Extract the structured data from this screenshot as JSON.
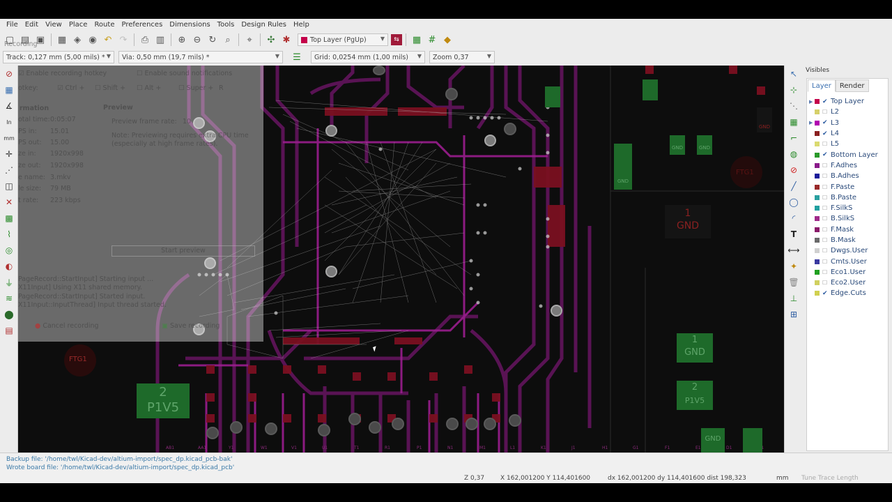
{
  "menu": [
    "File",
    "Edit",
    "View",
    "Place",
    "Route",
    "Preferences",
    "Dimensions",
    "Tools",
    "Design Rules",
    "Help"
  ],
  "toolbar": {
    "layer_combo": "Top Layer (PgUp)",
    "track_combo": "Track: 0,127 mm (5,00 mils) *",
    "via_combo": "Via: 0,50 mm (19,7 mils) *",
    "grid_combo": "Grid: 0,0254 mm (1,00 mils)",
    "zoom_combo": "Zoom 0,37"
  },
  "visibles": {
    "title": "Visibles",
    "tabs": [
      "Layer",
      "Render"
    ],
    "layers": [
      {
        "name": "Top Layer",
        "checked": true,
        "color": "#c4004a",
        "arrow": true
      },
      {
        "name": "L2",
        "checked": false,
        "color": "#d6d06a",
        "arrow": false
      },
      {
        "name": "L3",
        "checked": true,
        "color": "#b000b0",
        "arrow": true
      },
      {
        "name": "L4",
        "checked": true,
        "color": "#8a2020",
        "arrow": false
      },
      {
        "name": "L5",
        "checked": false,
        "color": "#dada70",
        "arrow": false
      },
      {
        "name": "Bottom Layer",
        "checked": true,
        "color": "#2a9a2a",
        "arrow": false
      },
      {
        "name": "F.Adhes",
        "checked": false,
        "color": "#8a1a8a",
        "arrow": false
      },
      {
        "name": "B.Adhes",
        "checked": false,
        "color": "#1a1a9a",
        "arrow": false
      },
      {
        "name": "F.Paste",
        "checked": false,
        "color": "#9a2a2a",
        "arrow": false
      },
      {
        "name": "B.Paste",
        "checked": false,
        "color": "#2aa0a0",
        "arrow": false
      },
      {
        "name": "F.SilkS",
        "checked": false,
        "color": "#20a0a0",
        "arrow": false
      },
      {
        "name": "B.SilkS",
        "checked": false,
        "color": "#a02a8a",
        "arrow": false
      },
      {
        "name": "F.Mask",
        "checked": false,
        "color": "#8a1a6a",
        "arrow": false
      },
      {
        "name": "B.Mask",
        "checked": false,
        "color": "#6a6a6a",
        "arrow": false
      },
      {
        "name": "Dwgs.User",
        "checked": false,
        "color": "#d0d0d0",
        "arrow": false
      },
      {
        "name": "Cmts.User",
        "checked": false,
        "color": "#3a3aa0",
        "arrow": false
      },
      {
        "name": "Eco1.User",
        "checked": false,
        "color": "#20a020",
        "arrow": false
      },
      {
        "name": "Eco2.User",
        "checked": false,
        "color": "#d0d060",
        "arrow": false
      },
      {
        "name": "Edge.Cuts",
        "checked": true,
        "color": "#d0d050",
        "arrow": false
      }
    ]
  },
  "status": {
    "msg1": "Backup file: '/home/twl/Kicad-dev/altium-import/spec_dp.kicad_pcb-bak'",
    "msg2": "Wrote board file: '/home/twl/Kicad-dev/altium-import/spec_dp.kicad_pcb'",
    "zoom": "Z 0,37",
    "xy": "X 162,001200  Y 114,401600",
    "dxy": "dx 162,001200  dy 114,401600  dist 198,323",
    "units": "mm",
    "tune": "Tune Trace Length"
  },
  "recorder": {
    "recording_label": "Recording",
    "hotkey_label": "Enable recording hotkey",
    "sound_label": "Enable sound notifications",
    "hotkey_row": [
      "otkey:",
      "Ctrl +",
      "Shift +",
      "Alt +",
      "Super +",
      "R"
    ],
    "info_title": "rmation",
    "preview_title": "Preview",
    "info_rows": [
      [
        "otal time:",
        "0:05:07"
      ],
      [
        "PS in:",
        "15.01"
      ],
      [
        "PS out:",
        "15.00"
      ],
      [
        "ze in:",
        "1920x998"
      ],
      [
        "ze out:",
        "1920x998"
      ],
      [
        "e name:",
        "3.mkv"
      ],
      [
        "le size:",
        "79 MB"
      ],
      [
        "t rate:",
        "223 kbps"
      ]
    ],
    "preview_rate_label": "Preview frame rate:",
    "preview_rate_value": "10",
    "note": "Note: Previewing requires extra CPU time (especially at high frame rates).",
    "start_preview": "Start preview",
    "log": [
      "PageRecord::StartInput] Starting input ...",
      "X11Input] Using X11 shared memory.",
      "PageRecord::StartInput] Started input.",
      "X11Input::InputThread] Input thread started."
    ],
    "cancel": "Cancel recording",
    "save": "Save recording"
  },
  "pcb_labels": {
    "ftg1_left": "FTG1",
    "ftg1_right": "FTG1",
    "gnd": "GND",
    "p1v5": "P1V5",
    "one": "1",
    "two": "2"
  }
}
